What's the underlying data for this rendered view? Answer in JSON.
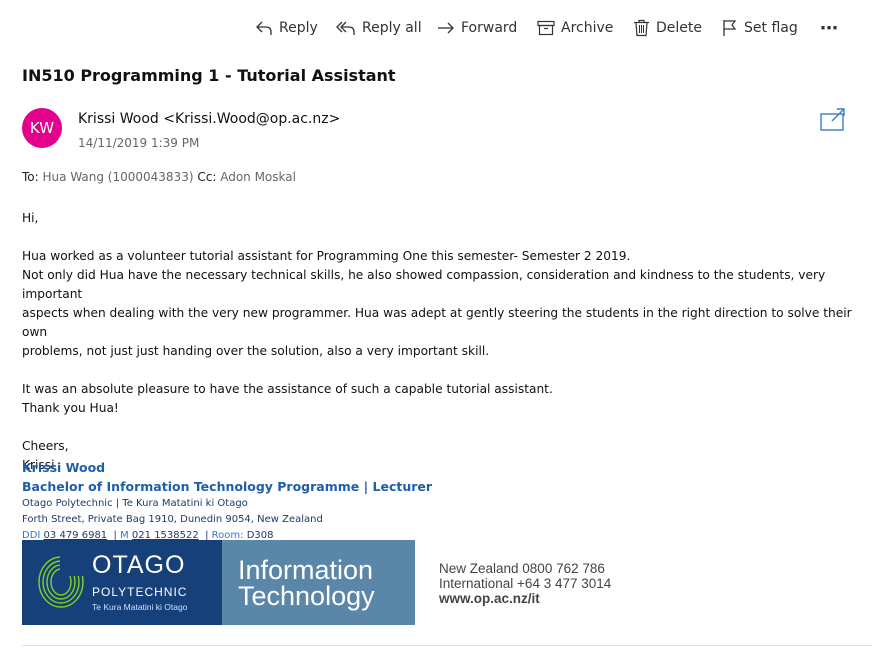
{
  "toolbar": {
    "reply": "Reply",
    "reply_all": "Reply all",
    "forward": "Forward",
    "archive": "Archive",
    "delete": "Delete",
    "set_flag": "Set flag",
    "more": "⋯"
  },
  "email": {
    "subject": "IN510 Programming 1 - Tutorial Assistant",
    "avatar_initials": "KW",
    "avatar_color": "#e3008c",
    "sender": "Krissi Wood <Krissi.Wood@op.ac.nz>",
    "date": "14/11/2019 1:39 PM",
    "to_label": "To:",
    "to": "Hua Wang (1000043833)",
    "cc_label": "Cc:",
    "cc": "Adon Moskal"
  },
  "body": {
    "greeting": "Hi,",
    "p1_line1": "Hua worked as a volunteer tutorial assistant for Programming One this semester- Semester 2 2019.",
    "p1_line2": "Not only did Hua have the necessary technical skills, he also showed compassion, consideration and kindness to the students, very important",
    "p1_line3": "aspects when dealing with the very new programmer.  Hua was adept at gently steering the students in the right direction to solve their own",
    "p1_line4": "problems,  not just just handing over the solution, also a very important skill.",
    "p2_line1": "It was an absolute pleasure to have the assistance of such a capable tutorial assistant.",
    "p2_line2": "Thank you Hua!",
    "closing": "Cheers,",
    "closing_name": "Krissi"
  },
  "signature": {
    "name": "Krissi Wood",
    "title": "Bachelor of Information Technology Programme | Lecturer",
    "org": "Otago Polytechnic | Te Kura Matatini ki Otago",
    "address": "Forth Street, Private Bag 1910, Dunedin 9054, New Zealand",
    "ddi_label": "DDI",
    "ddi": "03 479 6981",
    "sep1": "|",
    "mobile_label": "M",
    "mobile": "021 1538522",
    "sep2": "|",
    "room_label": "Room:",
    "room": "D308"
  },
  "banner": {
    "otago": "OTAGO",
    "polytechnic": "POLYTECHNIC",
    "tekura": "Te Kura Matatini ki Otago",
    "it_line1": "Information",
    "it_line2": "Technology",
    "phone_nz": "New Zealand 0800 762 786",
    "phone_int": "International  +64 3 477 3014",
    "website": "www.op.ac.nz/it",
    "logo_bg": "#15407a",
    "it_bg": "#5a86a8",
    "ring_color": "#7ed321"
  }
}
